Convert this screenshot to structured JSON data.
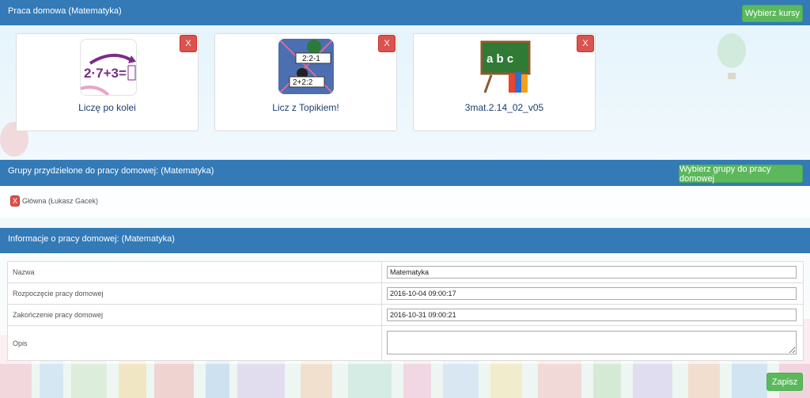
{
  "homework_panel": {
    "title": "Praca domowa (Matematyka)",
    "select_courses_label": "Wybierz kursy",
    "courses": [
      {
        "name": "Liczę po kolei",
        "thumb_text": "2·7+3=",
        "remove_label": "X"
      },
      {
        "name": "Licz z Topikiem!",
        "thumb_text_top": "2:2-1",
        "thumb_text_bottom": "2+2:2",
        "remove_label": "X"
      },
      {
        "name": "3mat.2.14_02_v05",
        "thumb_text": "a b c",
        "remove_label": "X"
      }
    ]
  },
  "groups_panel": {
    "title": "Grupy przydzielone do pracy domowej: (Matematyka)",
    "select_groups_label": "Wybierz grupy do pracy domowej",
    "groups": [
      {
        "name": "Główna (Łukasz Gacek)",
        "remove_label": "X"
      }
    ]
  },
  "info_panel": {
    "title": "Informacje o pracy domowej: (Matematyka)",
    "rows": [
      {
        "label": "Nazwa",
        "value": "Matematyka"
      },
      {
        "label": "Rozpoczęcie pracy domowej",
        "value": "2016-10-04 09:00:17"
      },
      {
        "label": "Zakończenie pracy domowej",
        "value": "2016-10-31 09:00:21"
      },
      {
        "label": "Opis",
        "value": ""
      }
    ],
    "save_label": "Zapisz"
  },
  "colors": {
    "header_blue": "#337ab7",
    "button_green": "#5cb85c",
    "button_red": "#d9534f"
  }
}
